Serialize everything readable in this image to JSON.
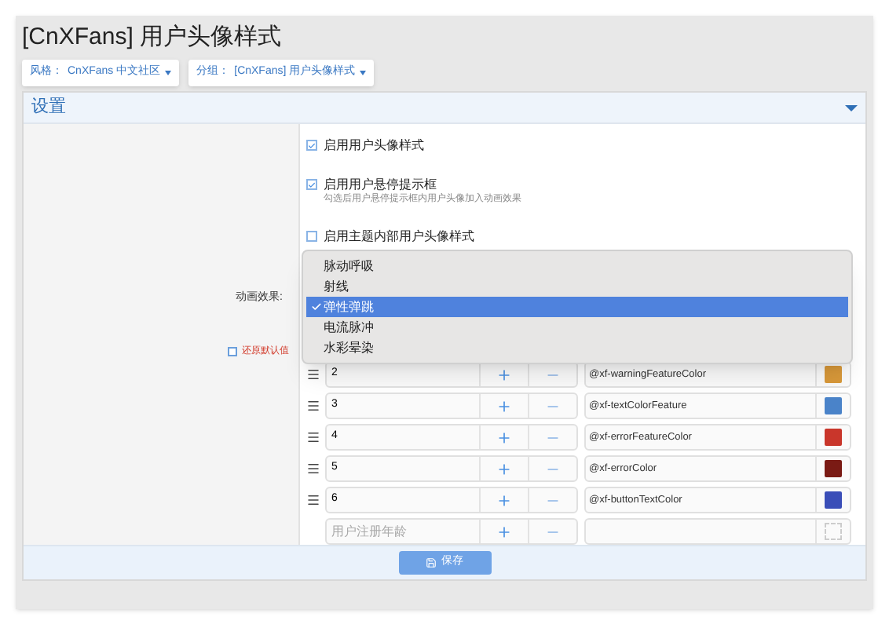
{
  "page_title": "[CnXFans] 用户头像样式",
  "filters": [
    {
      "label": "风格：",
      "value": "CnXFans 中文社区"
    },
    {
      "label": "分组：",
      "value": "[CnXFans] 用户头像样式"
    }
  ],
  "panel": {
    "title": "设置",
    "options": [
      {
        "label": "启用用户头像样式",
        "checked": true
      },
      {
        "label": "启用用户悬停提示框",
        "hint": "勾选后用户悬停提示框内用户头像加入动画效果",
        "checked": true
      },
      {
        "label": "启用主题内部用户头像样式",
        "checked": false
      }
    ],
    "animation": {
      "label": "动画效果:",
      "reset": {
        "label": "还原默认值",
        "checked": false
      },
      "options": [
        {
          "label": "脉动呼吸",
          "selected": false
        },
        {
          "label": "射线",
          "selected": false
        },
        {
          "label": "弹性弹跳",
          "selected": true
        },
        {
          "label": "电流脉冲",
          "selected": false
        },
        {
          "label": "水彩晕染",
          "selected": false
        }
      ]
    },
    "rows": [
      {
        "value": "2",
        "color_name": "@xf-warningFeatureColor",
        "color": "#d9993a"
      },
      {
        "value": "3",
        "color_name": "@xf-textColorFeature",
        "color": "#4a83c9"
      },
      {
        "value": "4",
        "color_name": "@xf-errorFeatureColor",
        "color": "#c9362b"
      },
      {
        "value": "5",
        "color_name": "@xf-errorColor",
        "color": "#7a1a14"
      },
      {
        "value": "6",
        "color_name": "@xf-buttonTextColor",
        "color": "#3a4eb8"
      }
    ],
    "new_row": {
      "placeholder": "用户注册年龄"
    },
    "save": "保存"
  }
}
